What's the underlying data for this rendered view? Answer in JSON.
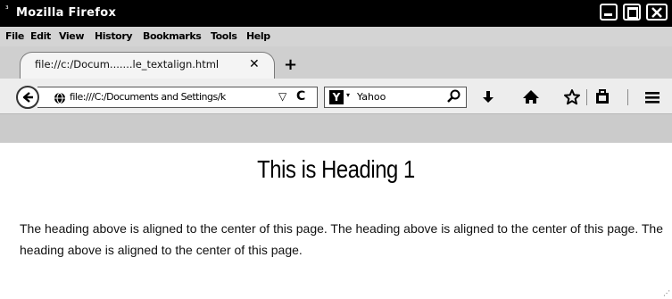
{
  "window": {
    "title": "Mozilla Firefox",
    "app_icon": "firefox-icon"
  },
  "menubar": {
    "items": [
      {
        "label": "File"
      },
      {
        "label": "Edit"
      },
      {
        "label": "View"
      },
      {
        "label": "History"
      },
      {
        "label": "Bookmarks"
      },
      {
        "label": "Tools"
      },
      {
        "label": "Help"
      }
    ]
  },
  "tabs": [
    {
      "label": "file://c:/Docum.......le_textalign.html",
      "active": true
    }
  ],
  "newtab": {
    "label": "+"
  },
  "navbar": {
    "url": "file:///C:/Documents and Settings/k",
    "url_dropdown": "▽",
    "reload": "C",
    "search": {
      "engine_icon_label": "Y",
      "engine_arrow": "▾",
      "placeholder": "Yahoo"
    },
    "icons": [
      "back-icon",
      "globe-icon",
      "search-go-icon",
      "download-icon",
      "home-icon",
      "bookmark-star-icon",
      "bookmarks-menu-icon",
      "hamburger-menu-icon"
    ]
  },
  "page": {
    "heading": "This is Heading 1",
    "paragraph": "The heading above is aligned to the center of this page. The heading above is aligned to the center of this page. The heading above is aligned to the center of this page."
  },
  "colors": {
    "titlebar": "#000000",
    "menubar": "#d4d4d4",
    "tabstrip": "#cfcfcf",
    "toolbar": "#ededed",
    "content": "#ffffff"
  }
}
